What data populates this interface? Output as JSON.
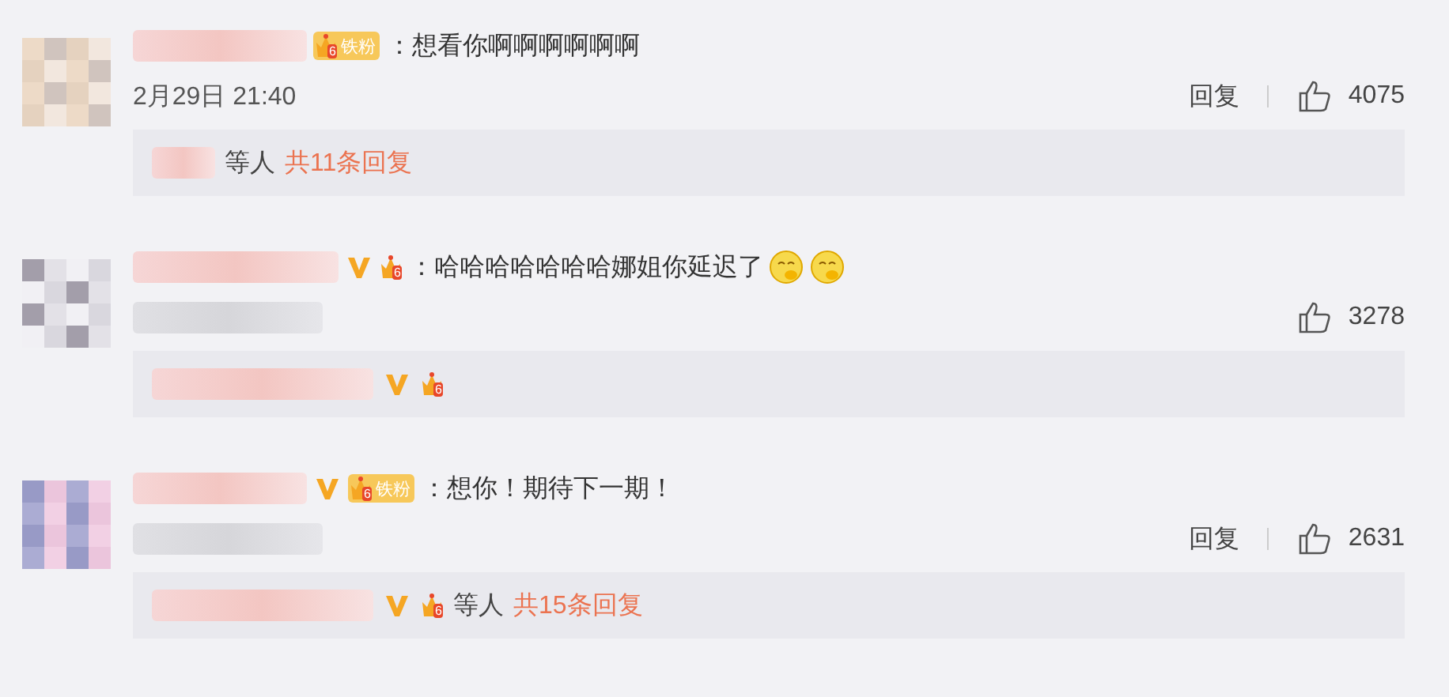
{
  "comments": [
    {
      "badges": [
        {
          "kind": "fan",
          "level": "6",
          "label": "铁粉"
        }
      ],
      "text": "：想看你啊啊啊啊啊啊",
      "time": "2月29日 21:40",
      "reply_label": "回复",
      "likes": "4075",
      "summary": {
        "suffix": "等人",
        "count": "共11条回复"
      }
    },
    {
      "badges": [
        {
          "kind": "verified"
        },
        {
          "kind": "crown",
          "level": "6"
        }
      ],
      "text": "：哈哈哈哈哈哈哈娜姐你延迟了",
      "emojis": [
        {
          "kind": "smirk"
        },
        {
          "kind": "smirk"
        }
      ],
      "likes": "3278",
      "summary": {
        "badges": [
          {
            "kind": "verified"
          },
          {
            "kind": "crown",
            "level": "6"
          }
        ]
      }
    },
    {
      "badges": [
        {
          "kind": "verified"
        },
        {
          "kind": "fan",
          "level": "6",
          "label": "铁粉"
        }
      ],
      "text": "：想你！期待下一期！",
      "reply_label": "回复",
      "likes": "2631",
      "summary": {
        "badges": [
          {
            "kind": "verified"
          },
          {
            "kind": "crown",
            "level": "6"
          }
        ],
        "suffix": "等人",
        "count": "共15条回复"
      }
    }
  ]
}
